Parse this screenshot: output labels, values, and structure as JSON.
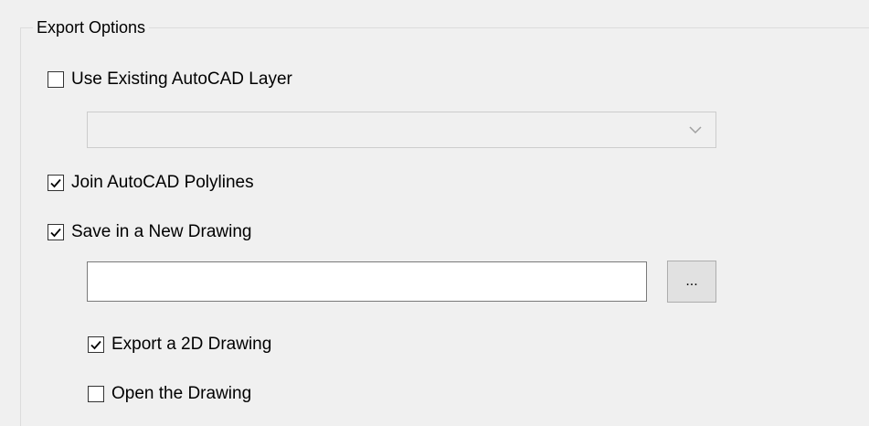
{
  "group": {
    "title": "Export Options"
  },
  "options": {
    "use_existing_layer": {
      "label": "Use Existing AutoCAD Layer",
      "checked": false
    },
    "layer_select": {
      "value": "",
      "enabled": false
    },
    "join_polylines": {
      "label": "Join AutoCAD Polylines",
      "checked": true
    },
    "save_new_drawing": {
      "label": "Save in a New Drawing",
      "checked": true
    },
    "drawing_path": {
      "value": ""
    },
    "browse_button": {
      "label": "..."
    },
    "export_2d": {
      "label": "Export a 2D Drawing",
      "checked": true
    },
    "open_drawing": {
      "label": "Open the Drawing",
      "checked": false
    }
  },
  "colors": {
    "panel_background": "#f0f0f0",
    "groupbox_border": "#dcdcdc",
    "checkbox_border": "#333333",
    "disabled_combo_border": "#cccccc",
    "button_background": "#e1e1e1"
  },
  "icons": {
    "checkmark": "check-icon",
    "dropdown": "chevron-down-icon"
  }
}
